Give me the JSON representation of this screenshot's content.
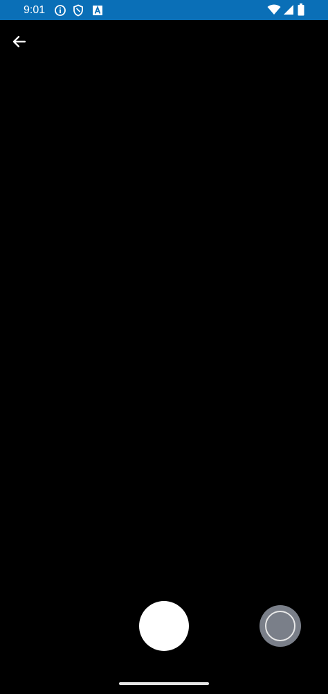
{
  "status_bar": {
    "time": "9:01",
    "background": "#0a6fb7",
    "icons": [
      "info-icon",
      "shield-icon",
      "accessibility-a-icon",
      "wifi-icon",
      "signal-icon",
      "battery-icon"
    ]
  },
  "toolbar": {
    "back_icon": "arrow-left-icon"
  },
  "camera": {
    "shutter_icon": "shutter-button",
    "gallery_icon": "gallery-thumbnail"
  },
  "colors": {
    "background": "#000000",
    "shutter": "#ffffff",
    "gallery": "#7a7f89"
  }
}
